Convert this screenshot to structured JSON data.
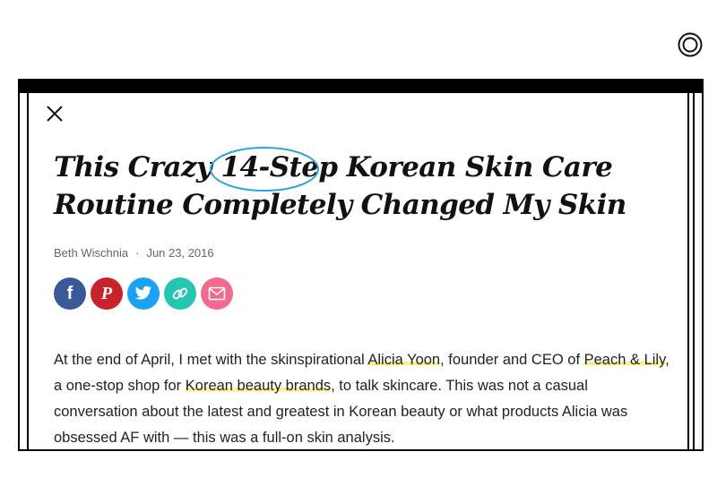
{
  "article": {
    "title_part1": "This Crazy ",
    "title_circled": "14-Step",
    "title_part2": " Korean Skin Care Routine Completely Changed My Skin",
    "author": "Beth Wischnia",
    "separator": "·",
    "date": "Jun 23, 2016",
    "body": {
      "t1": "At the end of April, I met with the skinspirational ",
      "link1": "Alicia Yoon",
      "t2": ", founder and CEO of ",
      "link2": "Peach & Lily",
      "t3": ", a one-stop shop for ",
      "link3": "Korean beauty brands",
      "t4": ", to talk skincare. This was not a casual conversation about the latest and greatest in Korean beauty or what products Alicia was obsessed AF with — this was a full-on skin analysis."
    }
  },
  "share": {
    "facebook_glyph": "f",
    "pinterest_glyph": "P"
  },
  "icons": {
    "top_right": "target-icon",
    "close": "close-icon",
    "facebook": "facebook-icon",
    "pinterest": "pinterest-icon",
    "twitter": "twitter-icon",
    "link": "link-icon",
    "email": "email-icon"
  },
  "colors": {
    "facebook": "#3b5998",
    "pinterest": "#c8232c",
    "twitter": "#1da1f2",
    "link": "#25c4b3",
    "email": "#f06a8e",
    "highlight": "#fdf08a",
    "annotation_circle": "#2aa6d6"
  }
}
